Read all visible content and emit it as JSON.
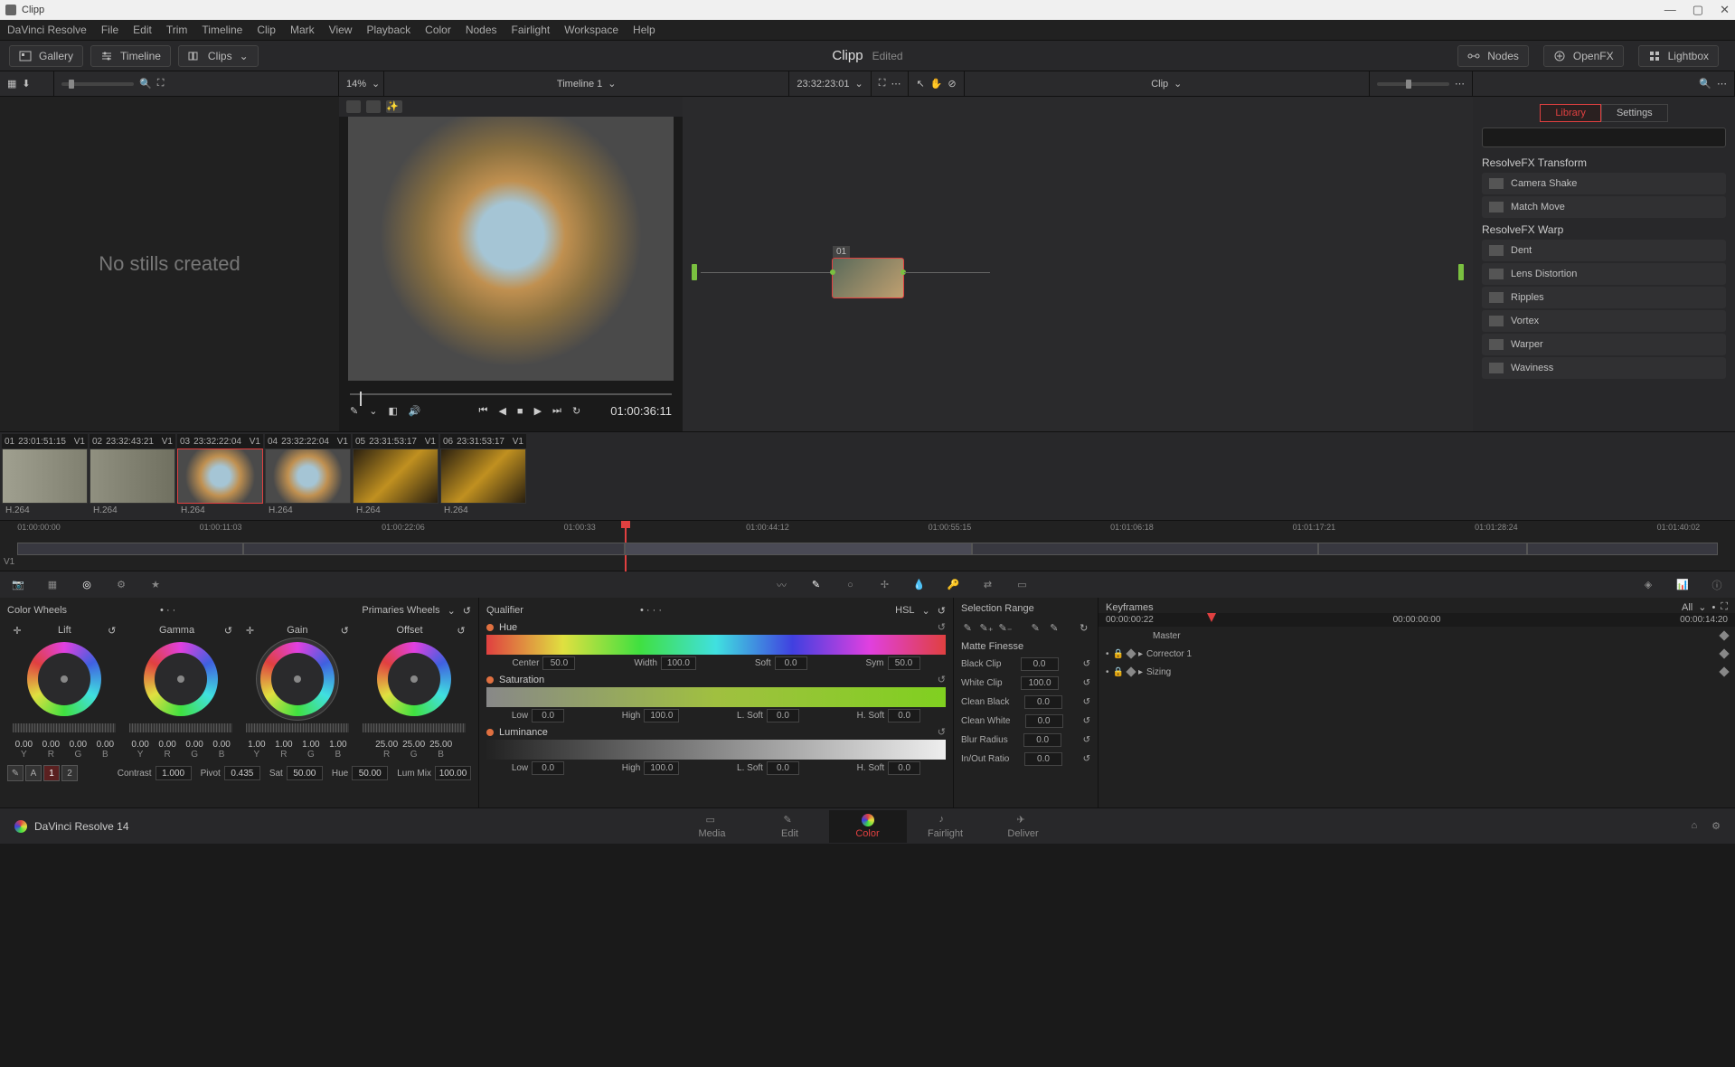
{
  "window": {
    "title": "Clipp"
  },
  "menu": [
    "DaVinci Resolve",
    "File",
    "Edit",
    "Trim",
    "Timeline",
    "Clip",
    "Mark",
    "View",
    "Playback",
    "Color",
    "Nodes",
    "Fairlight",
    "Workspace",
    "Help"
  ],
  "topbar": {
    "gallery": "Gallery",
    "timeline": "Timeline",
    "clips": "Clips",
    "titleName": "Clipp",
    "titleStatus": "Edited",
    "nodes": "Nodes",
    "openfx": "OpenFX",
    "lightbox": "Lightbox"
  },
  "toolrow": {
    "zoom": "14%",
    "timelineName": "Timeline 1",
    "timelineTc": "23:32:23:01",
    "clipLabel": "Clip"
  },
  "gallery": {
    "empty": "No stills created"
  },
  "viewer": {
    "tc": "01:00:36:11"
  },
  "node": {
    "label": "01"
  },
  "fx": {
    "tabs": {
      "library": "Library",
      "settings": "Settings"
    },
    "groups": [
      {
        "title": "ResolveFX Transform",
        "items": [
          "Camera Shake",
          "Match Move"
        ]
      },
      {
        "title": "ResolveFX Warp",
        "items": [
          "Dent",
          "Lens Distortion",
          "Ripples",
          "Vortex",
          "Warper",
          "Waviness"
        ]
      }
    ]
  },
  "clips": [
    {
      "num": "01",
      "tc": "23:01:51:15",
      "trk": "V1",
      "fmt": "H.264",
      "cls": "c1"
    },
    {
      "num": "02",
      "tc": "23:32:43:21",
      "trk": "V1",
      "fmt": "H.264",
      "cls": "c2"
    },
    {
      "num": "03",
      "tc": "23:32:22:04",
      "trk": "V1",
      "fmt": "H.264",
      "cls": "c3",
      "sel": true
    },
    {
      "num": "04",
      "tc": "23:32:22:04",
      "trk": "V1",
      "fmt": "H.264",
      "cls": "c3"
    },
    {
      "num": "05",
      "tc": "23:31:53:17",
      "trk": "V1",
      "fmt": "H.264",
      "cls": "c4"
    },
    {
      "num": "06",
      "tc": "23:31:53:17",
      "trk": "V1",
      "fmt": "H.264",
      "cls": "c4"
    }
  ],
  "ruler": {
    "ticks": [
      "01:00:00:00",
      "01:00:11:03",
      "01:00:22:06",
      "01:00:33",
      "01:00:44:12",
      "01:00:55:15",
      "01:01:06:18",
      "01:01:17:21",
      "01:01:28:24",
      "01:01:40:02"
    ],
    "track": "V1"
  },
  "wheels": {
    "title": "Color Wheels",
    "mode": "Primaries Wheels",
    "cols": [
      {
        "name": "Lift",
        "vals": [
          "0.00",
          "0.00",
          "0.00",
          "0.00"
        ]
      },
      {
        "name": "Gamma",
        "vals": [
          "0.00",
          "0.00",
          "0.00",
          "0.00"
        ]
      },
      {
        "name": "Gain",
        "vals": [
          "1.00",
          "1.00",
          "1.00",
          "1.00"
        ]
      },
      {
        "name": "Offset",
        "vals": [
          "25.00",
          "25.00",
          "25.00"
        ]
      }
    ],
    "yrgb": [
      "Y",
      "R",
      "G",
      "B"
    ],
    "rgb": [
      "R",
      "G",
      "B"
    ],
    "footer": {
      "chips": [
        "A",
        "1",
        "2"
      ],
      "contrast": "Contrast",
      "contrastV": "1.000",
      "pivot": "Pivot",
      "pivotV": "0.435",
      "sat": "Sat",
      "satV": "50.00",
      "hue": "Hue",
      "hueV": "50.00",
      "lummix": "Lum Mix",
      "lummixV": "100.00"
    }
  },
  "qualifier": {
    "title": "Qualifier",
    "mode": "HSL",
    "hue": {
      "label": "Hue",
      "center": "Center",
      "centerV": "50.0",
      "width": "Width",
      "widthV": "100.0",
      "soft": "Soft",
      "softV": "0.0",
      "sym": "Sym",
      "symV": "50.0"
    },
    "sat": {
      "label": "Saturation",
      "low": "Low",
      "lowV": "0.0",
      "high": "High",
      "highV": "100.0",
      "lsoft": "L. Soft",
      "lsoftV": "0.0",
      "hsoft": "H. Soft",
      "hsoftV": "0.0"
    },
    "lum": {
      "label": "Luminance",
      "low": "Low",
      "lowV": "0.0",
      "high": "High",
      "highV": "100.0",
      "lsoft": "L. Soft",
      "lsoftV": "0.0",
      "hsoft": "H. Soft",
      "hsoftV": "0.0"
    }
  },
  "matte": {
    "sel": "Selection Range",
    "fin": "Matte Finesse",
    "rows": [
      {
        "l": "Black Clip",
        "v": "0.0"
      },
      {
        "l": "White Clip",
        "v": "100.0"
      },
      {
        "l": "Clean Black",
        "v": "0.0"
      },
      {
        "l": "Clean White",
        "v": "0.0"
      },
      {
        "l": "Blur Radius",
        "v": "0.0"
      },
      {
        "l": "In/Out Ratio",
        "v": "0.0"
      }
    ]
  },
  "keyframes": {
    "title": "Keyframes",
    "all": "All",
    "tcCur": "00:00:00:22",
    "tcStart": "00:00:00:00",
    "tcEnd": "00:00:14:20",
    "rows": [
      "Master",
      "Corrector 1",
      "Sizing"
    ]
  },
  "bottombar": {
    "app": "DaVinci Resolve 14",
    "pages": [
      "Media",
      "Edit",
      "Color",
      "Fairlight",
      "Deliver"
    ]
  }
}
